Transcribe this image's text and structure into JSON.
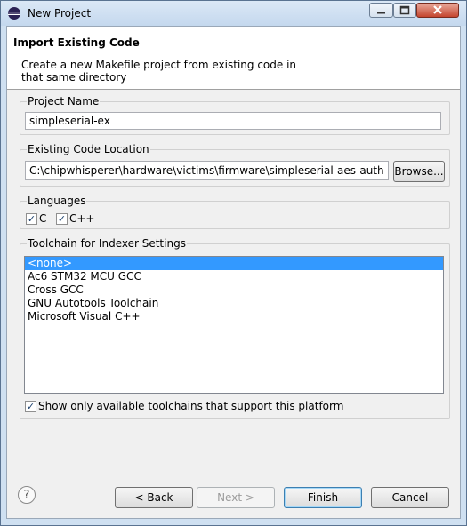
{
  "window": {
    "title": "New Project"
  },
  "banner": {
    "title": "Import Existing Code",
    "description": "Create a new Makefile project from existing code in that same directory"
  },
  "project_name": {
    "label": "Project Name",
    "value": "simpleserial-ex"
  },
  "code_location": {
    "label": "Existing Code Location",
    "value": "C:\\chipwhisperer\\hardware\\victims\\firmware\\simpleserial-aes-auth",
    "browse_label": "Browse..."
  },
  "languages": {
    "label": "Languages",
    "items": [
      {
        "label": "C",
        "checked": true
      },
      {
        "label": "C++",
        "checked": true
      }
    ]
  },
  "toolchain": {
    "label": "Toolchain for Indexer Settings",
    "items": [
      "<none>",
      "Ac6 STM32 MCU GCC",
      "Cross GCC",
      "GNU Autotools Toolchain",
      "Microsoft Visual C++"
    ],
    "selected": "<none>",
    "filter_label": "Show only available toolchains that support this platform",
    "filter_checked": true
  },
  "buttons": {
    "back": "< Back",
    "next": "Next >",
    "finish": "Finish",
    "cancel": "Cancel"
  },
  "icons": {
    "app": "eclipse-icon",
    "help": "help-icon",
    "check": "✓"
  }
}
